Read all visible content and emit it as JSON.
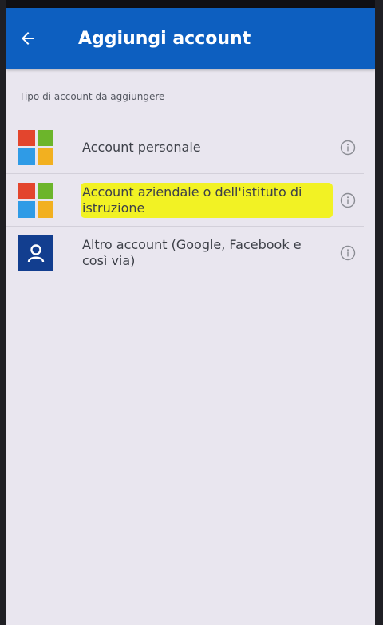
{
  "appbar": {
    "title": "Aggiungi account",
    "color": "#0d5fc0",
    "back_icon": "arrow-left-icon"
  },
  "section": {
    "label": "Tipo di account da aggiungere"
  },
  "accounts": [
    {
      "label": "Account personale",
      "icon": "microsoft-logo-icon",
      "highlighted": false
    },
    {
      "label": "Account aziendale o dell'istituto di istruzione",
      "icon": "microsoft-logo-icon",
      "highlighted": true
    },
    {
      "label": "Altro account (Google, Facebook e così via)",
      "icon": "person-icon",
      "highlighted": false
    }
  ],
  "colors": {
    "background": "#e9e6ef",
    "highlight": "#f2f224",
    "ms_red": "#e3452d",
    "ms_green": "#6cb52b",
    "ms_blue": "#2f9be6",
    "ms_yellow": "#f2b020"
  }
}
